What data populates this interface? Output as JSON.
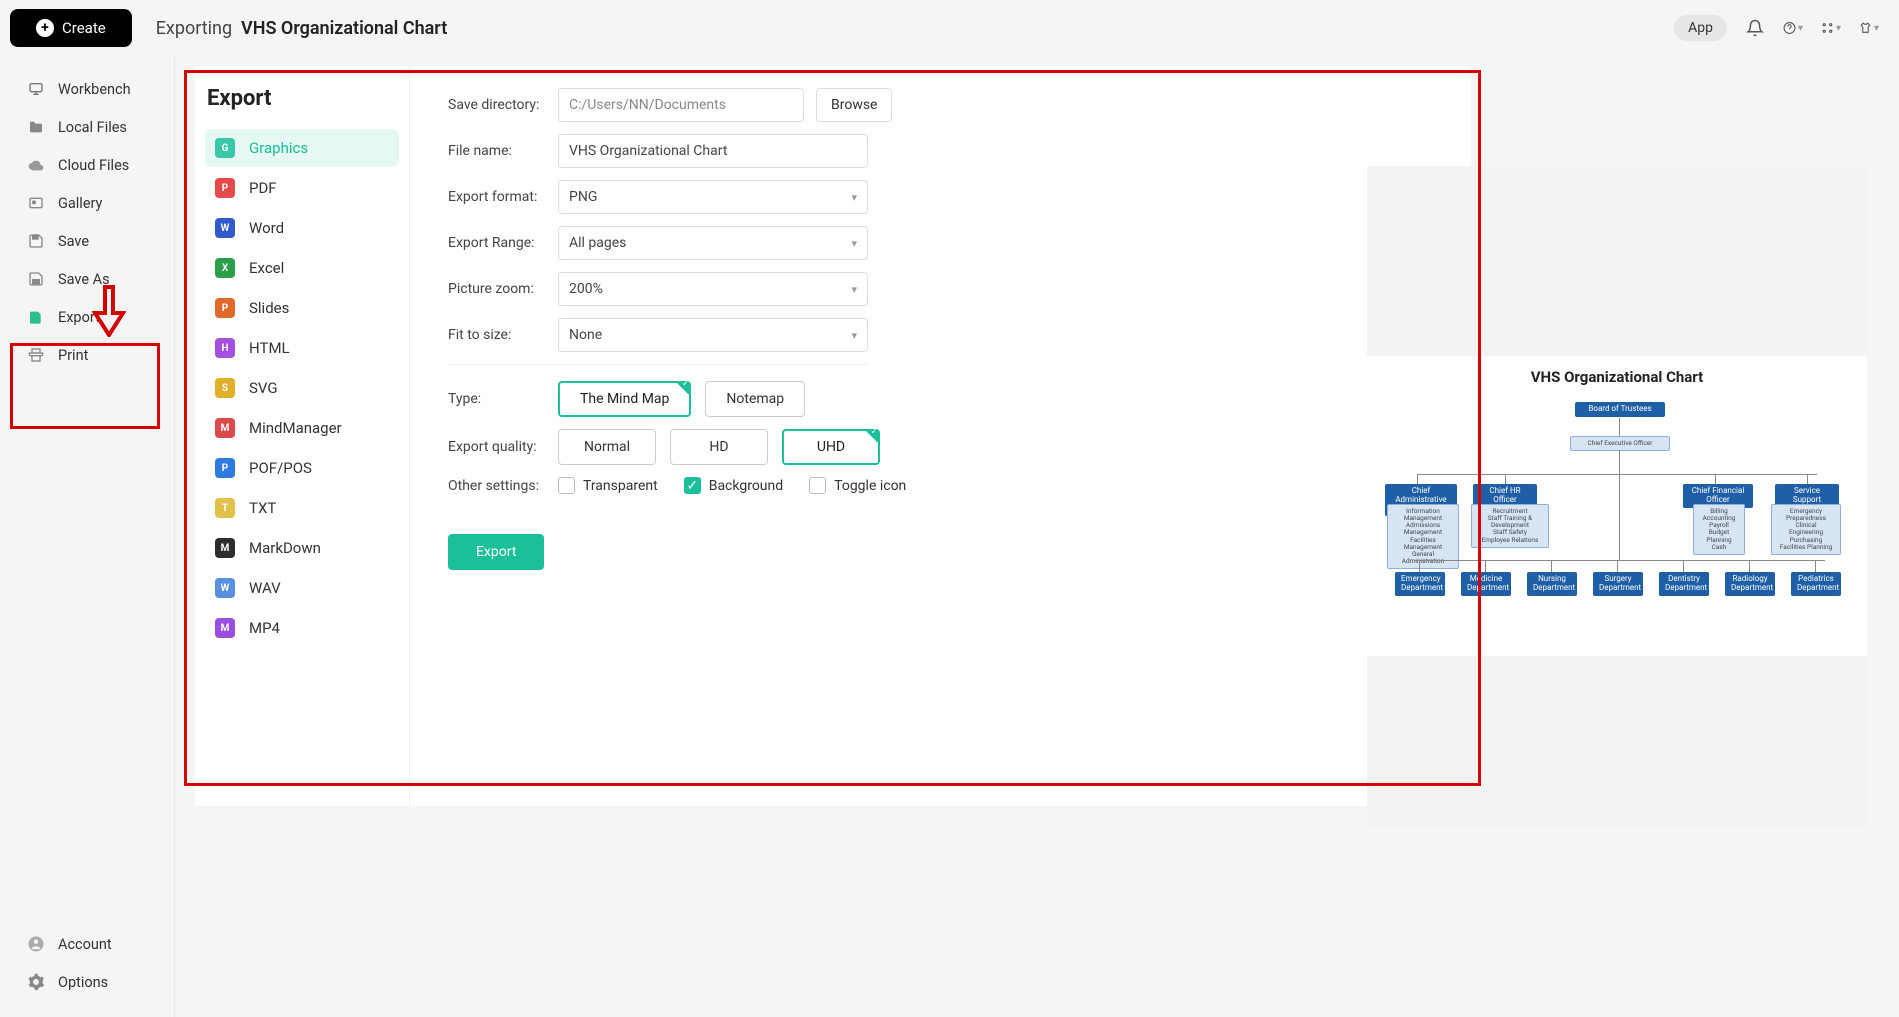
{
  "header": {
    "create_label": "Create",
    "exporting_label": "Exporting",
    "doc_title": "VHS Organizational Chart",
    "app_chip": "App"
  },
  "sidebar": {
    "items": [
      {
        "label": "Workbench"
      },
      {
        "label": "Local Files"
      },
      {
        "label": "Cloud Files"
      },
      {
        "label": "Gallery"
      },
      {
        "label": "Save"
      },
      {
        "label": "Save As"
      },
      {
        "label": "Export"
      },
      {
        "label": "Print"
      }
    ],
    "bottom": [
      {
        "label": "Account"
      },
      {
        "label": "Options"
      }
    ]
  },
  "export": {
    "title": "Export",
    "formats": [
      {
        "label": "Graphics",
        "color": "#38c7a8",
        "abbr": "G"
      },
      {
        "label": "PDF",
        "color": "#e64b4b",
        "abbr": "P"
      },
      {
        "label": "Word",
        "color": "#2f5bcc",
        "abbr": "W"
      },
      {
        "label": "Excel",
        "color": "#2b9e4a",
        "abbr": "X"
      },
      {
        "label": "Slides",
        "color": "#e06a2b",
        "abbr": "P"
      },
      {
        "label": "HTML",
        "color": "#a54fe0",
        "abbr": "H"
      },
      {
        "label": "SVG",
        "color": "#e0b02b",
        "abbr": "S"
      },
      {
        "label": "MindManager",
        "color": "#d94b4b",
        "abbr": "M"
      },
      {
        "label": "POF/POS",
        "color": "#2f7be0",
        "abbr": "P"
      },
      {
        "label": "TXT",
        "color": "#e0c24b",
        "abbr": "T"
      },
      {
        "label": "MarkDown",
        "color": "#2d2d2d",
        "abbr": "M"
      },
      {
        "label": "WAV",
        "color": "#5a8fe0",
        "abbr": "W"
      },
      {
        "label": "MP4",
        "color": "#9b4fe0",
        "abbr": "M"
      }
    ],
    "labels": {
      "save_dir": "Save directory:",
      "file_name": "File name:",
      "format": "Export format:",
      "range": "Export Range:",
      "zoom": "Picture zoom:",
      "fit": "Fit to size:",
      "type": "Type:",
      "quality": "Export quality:",
      "other": "Other settings:"
    },
    "values": {
      "save_dir": "C:/Users/NN/Documents",
      "browse": "Browse",
      "file_name": "VHS Organizational Chart",
      "format": "PNG",
      "range": "All pages",
      "zoom": "200%",
      "fit": "None"
    },
    "type_options": [
      {
        "label": "The Mind Map",
        "selected": true
      },
      {
        "label": "Notemap",
        "selected": false
      }
    ],
    "quality_options": [
      {
        "label": "Normal",
        "selected": false
      },
      {
        "label": "HD",
        "selected": false
      },
      {
        "label": "UHD",
        "selected": true
      }
    ],
    "checks": {
      "transparent": {
        "label": "Transparent",
        "checked": false
      },
      "background": {
        "label": "Background",
        "checked": true
      },
      "toggle_icon": {
        "label": "Toggle icon",
        "checked": false
      }
    },
    "export_btn": "Export"
  },
  "chart_data": {
    "type": "org-chart",
    "title": "VHS Organizational Chart",
    "nodes": {
      "trustees": "Board of Trustees",
      "ceo": "Chief Executive Officer",
      "cao": "Chief Administrative Officer",
      "chr": "Chief HR  Officer",
      "cfo": "Chief Financial Officer",
      "ssd": "Service Support Director",
      "cao_sub": "Information Management\nAdmissions Management\nFacilities Management\nGeneral Administration",
      "chr_sub": "Recruitment\nStaff Training & Development\nStaff Safety\nEmployee Relations",
      "cfo_sub": "Billing\nAccounting\nPayroll\nBudget Planning\nCash",
      "ssd_sub": "Emergency Preparedness\nClinical Engineering\nPurchasing\nFacilities Planning",
      "depts": [
        "Emergency Department",
        "Medicine Department",
        "Nursing Department",
        "Surgery Department",
        "Dentistry Department",
        "Radiology Department",
        "Pediatrics Department"
      ]
    }
  }
}
